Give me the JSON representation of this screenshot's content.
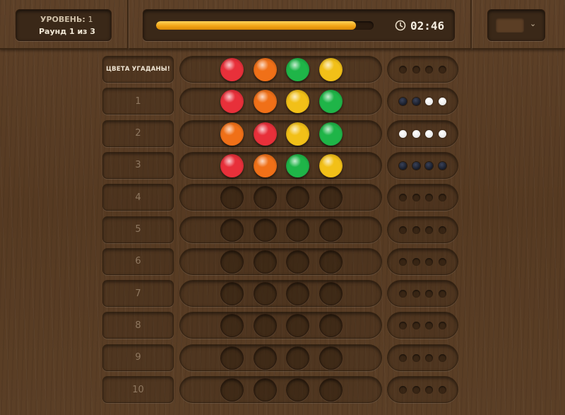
{
  "header": {
    "level_label": "УРОВЕНЬ:",
    "level_value": "1",
    "round_text": "Раунд 1 из 3",
    "progress_fraction": 0.92,
    "timer": "02:46",
    "select_color": "#5b3e25"
  },
  "colors": {
    "red": "#e8303a",
    "orange": "#f07018",
    "green": "#1fb548",
    "yellow": "#f2c018"
  },
  "secret_row": {
    "label": "ЦВЕТА УГАДАНЫ!",
    "pegs": [
      "red",
      "orange",
      "green",
      "yellow"
    ],
    "keys": [
      "empty",
      "empty",
      "empty",
      "empty"
    ]
  },
  "rows": [
    {
      "label": "1",
      "pegs": [
        "red",
        "orange",
        "yellow",
        "green"
      ],
      "keys": [
        "black",
        "black",
        "white",
        "white"
      ]
    },
    {
      "label": "2",
      "pegs": [
        "orange",
        "red",
        "yellow",
        "green"
      ],
      "keys": [
        "white",
        "white",
        "white",
        "white"
      ]
    },
    {
      "label": "3",
      "pegs": [
        "red",
        "orange",
        "green",
        "yellow"
      ],
      "keys": [
        "black",
        "black",
        "black",
        "black"
      ]
    },
    {
      "label": "4",
      "pegs": [
        "empty",
        "empty",
        "empty",
        "empty"
      ],
      "keys": [
        "empty",
        "empty",
        "empty",
        "empty"
      ]
    },
    {
      "label": "5",
      "pegs": [
        "empty",
        "empty",
        "empty",
        "empty"
      ],
      "keys": [
        "empty",
        "empty",
        "empty",
        "empty"
      ]
    },
    {
      "label": "6",
      "pegs": [
        "empty",
        "empty",
        "empty",
        "empty"
      ],
      "keys": [
        "empty",
        "empty",
        "empty",
        "empty"
      ]
    },
    {
      "label": "7",
      "pegs": [
        "empty",
        "empty",
        "empty",
        "empty"
      ],
      "keys": [
        "empty",
        "empty",
        "empty",
        "empty"
      ]
    },
    {
      "label": "8",
      "pegs": [
        "empty",
        "empty",
        "empty",
        "empty"
      ],
      "keys": [
        "empty",
        "empty",
        "empty",
        "empty"
      ]
    },
    {
      "label": "9",
      "pegs": [
        "empty",
        "empty",
        "empty",
        "empty"
      ],
      "keys": [
        "empty",
        "empty",
        "empty",
        "empty"
      ]
    },
    {
      "label": "10",
      "pegs": [
        "empty",
        "empty",
        "empty",
        "empty"
      ],
      "keys": [
        "empty",
        "empty",
        "empty",
        "empty"
      ]
    }
  ]
}
